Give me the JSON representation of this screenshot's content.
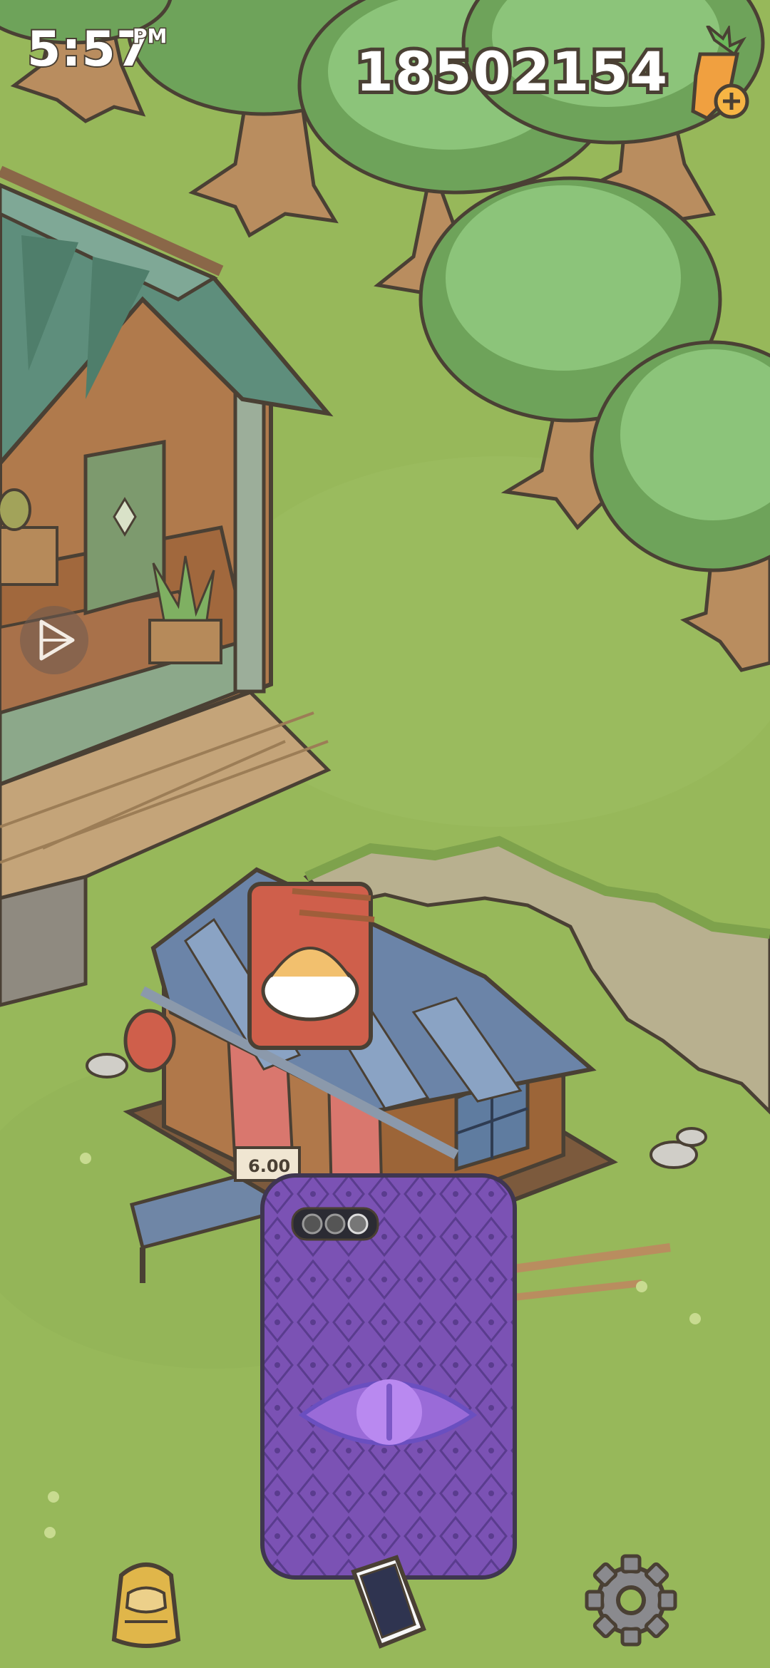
{
  "hud": {
    "time": "5:57",
    "ampm": "PM",
    "currency": "18502154"
  },
  "shop": {
    "sign_text": "6.00"
  },
  "icons": {
    "currency": "carrot-plus-icon",
    "side": "play-triangle-icon",
    "inventory": "backpack-icon",
    "device": "phone-icon",
    "settings": "gear-icon",
    "phone_art": "eye-icon"
  },
  "colors": {
    "grass": "#97b85a",
    "tree": "#6ea35a",
    "outline": "#4a4034",
    "phone_case": "#7b52b4"
  }
}
